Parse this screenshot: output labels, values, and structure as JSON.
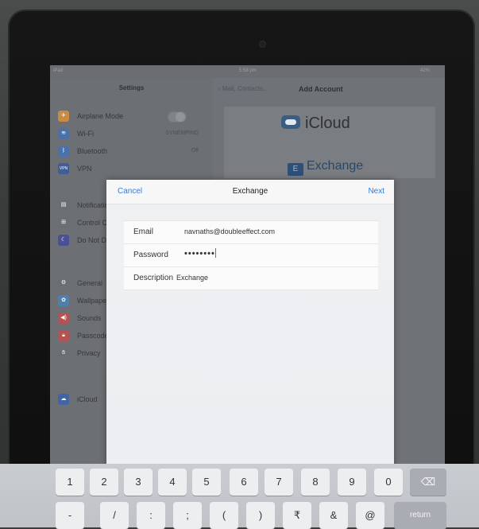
{
  "status_bar": {
    "left": "iPad",
    "time": "5:58 pm",
    "battery": "42%"
  },
  "settings": {
    "title": "Settings",
    "items": [
      {
        "label": "Airplane Mode",
        "icon": "airplane-icon",
        "color": "#d9822b",
        "value": ""
      },
      {
        "label": "Wi-Fi",
        "icon": "wifi-icon",
        "color": "#3b7dd8",
        "value": "SYNEMPIND"
      },
      {
        "label": "Bluetooth",
        "icon": "bluetooth-icon",
        "color": "#3b7dd8",
        "value": "Off"
      },
      {
        "label": "VPN",
        "icon": "vpn-icon",
        "color": "#3b63b8",
        "value": ""
      },
      {
        "label": "Notifications",
        "icon": "notifications-icon",
        "color": "#7a7d81",
        "value": ""
      },
      {
        "label": "Control Center",
        "icon": "control-center-icon",
        "color": "#7a7d81",
        "value": ""
      },
      {
        "label": "Do Not Disturb",
        "icon": "moon-icon",
        "color": "#4b4fa8",
        "value": ""
      },
      {
        "label": "General",
        "icon": "gear-icon",
        "color": "#7a7d81",
        "value": ""
      },
      {
        "label": "Wallpapers",
        "icon": "wallpaper-icon",
        "color": "#3a8ed8",
        "value": ""
      },
      {
        "label": "Sounds",
        "icon": "sound-icon",
        "color": "#d84a4a",
        "value": ""
      },
      {
        "label": "Passcode",
        "icon": "lock-icon",
        "color": "#d84a4a",
        "value": ""
      },
      {
        "label": "Privacy",
        "icon": "hand-icon",
        "color": "#7a7d81",
        "value": ""
      },
      {
        "label": "iCloud",
        "icon": "cloud-icon",
        "color": "#3a6fd0",
        "value": ""
      }
    ]
  },
  "add_account": {
    "back_label": "Mail, Contacts...",
    "title": "Add Account",
    "icloud_label": "iCloud",
    "exchange_label": "Exchange"
  },
  "modal": {
    "cancel": "Cancel",
    "title": "Exchange",
    "next": "Next",
    "fields": {
      "email_label": "Email",
      "email_value": "navnaths@doubleeffect.com",
      "password_label": "Password",
      "password_value": "••••••••",
      "description_label": "Description",
      "description_value": "Exchange"
    }
  },
  "keyboard": {
    "row1": [
      "1",
      "2",
      "3",
      "4",
      "5",
      "6",
      "7",
      "8",
      "9",
      "0"
    ],
    "row2": [
      "-",
      "/",
      ":",
      ";",
      "(",
      ")",
      "₹",
      "&",
      "@"
    ],
    "delete": "⌫",
    "return": "return"
  }
}
